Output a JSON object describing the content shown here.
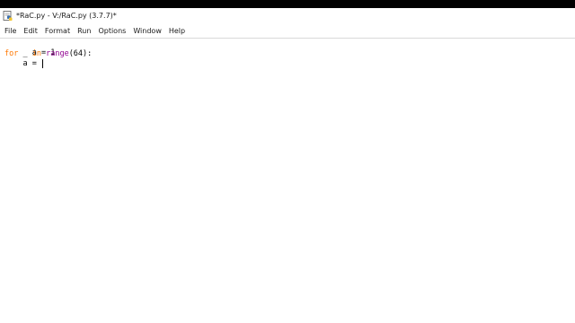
{
  "window": {
    "title": "*RaC.py - V:/RaC.py (3.7.7)*",
    "icon": "python-idle-icon"
  },
  "menu": {
    "items": [
      {
        "label": "File"
      },
      {
        "label": "Edit"
      },
      {
        "label": "Format"
      },
      {
        "label": "Run"
      },
      {
        "label": "Options"
      },
      {
        "label": "Window"
      },
      {
        "label": "Help"
      }
    ]
  },
  "editor": {
    "line1": "a = 1",
    "line2": {
      "kw_for": "for",
      "var": " _ ",
      "kw_in": "in",
      "space": " ",
      "builtin": "range",
      "rest": "(64):"
    },
    "line3": "    a = "
  },
  "colors": {
    "keyword": "#ff7700",
    "builtin": "#900090",
    "text": "#000000"
  }
}
